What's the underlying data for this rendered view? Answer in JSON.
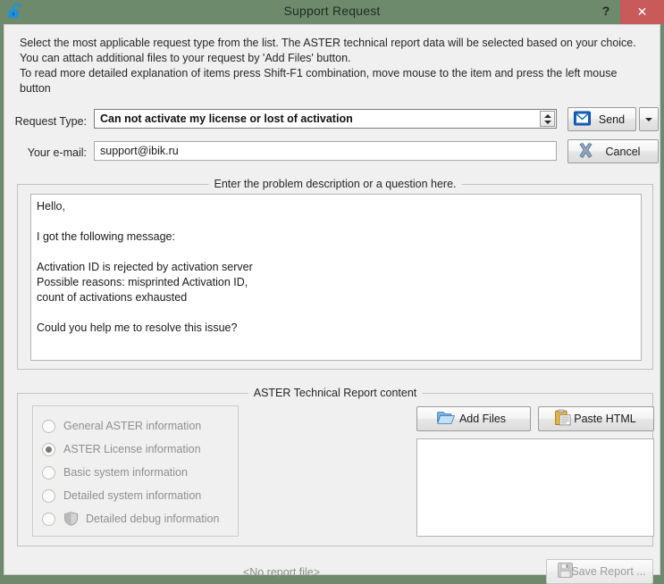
{
  "window": {
    "title": "Support Request",
    "lock_icon": "open-padlock-icon",
    "help_label": "?",
    "close_label": "✕",
    "titlebar_color": "#6d8a6d",
    "close_color": "#c85a5a"
  },
  "intro": {
    "text": "Select the most applicable request type from the list. The ASTER technical report data will be selected based on your choice.\nYou can attach additional files to your request by 'Add Files' button.\nTo read more detailed explanation of items press Shift-F1 combination, move mouse to the item and press the left mouse button"
  },
  "form": {
    "request_type_label": "Request Type:",
    "request_type_value": "Can not activate my license or lost of activation",
    "email_label": "Your e-mail:",
    "email_value": "support@ibik.ru",
    "email_placeholder": "support@ibik.ru"
  },
  "actions": {
    "send_label": "Send",
    "send_icon": "envelope-icon",
    "send_dropdown_icon": "chevron-down-icon",
    "cancel_label": "Cancel",
    "cancel_icon": "x-cross-icon"
  },
  "description_group": {
    "title": "Enter the problem description or a question here.",
    "value": "Hello,\n\nI got the following message:\n\nActivation ID is rejected by activation server\nPossible reasons: misprinted Activation ID,\ncount of activations exhausted\n\nCould you help me to resolve this issue?"
  },
  "report_group": {
    "title": "ASTER Technical Report content",
    "options": [
      {
        "label": "General ASTER information",
        "checked": false,
        "icon": null
      },
      {
        "label": "ASTER License information",
        "checked": true,
        "icon": null
      },
      {
        "label": "Basic system information",
        "checked": false,
        "icon": null
      },
      {
        "label": "Detailed system information",
        "checked": false,
        "icon": null
      },
      {
        "label": "Detailed debug information",
        "checked": false,
        "icon": "uac-shield-icon"
      }
    ],
    "add_files_label": "Add Files",
    "add_files_icon": "open-folder-icon",
    "paste_html_label": "Paste HTML",
    "paste_html_icon": "clipboard-icon",
    "attachment_list_items": []
  },
  "footer": {
    "status_text": "<No report file>",
    "save_report_label": "Save Report ...",
    "save_report_icon": "floppy-disk-icon"
  }
}
